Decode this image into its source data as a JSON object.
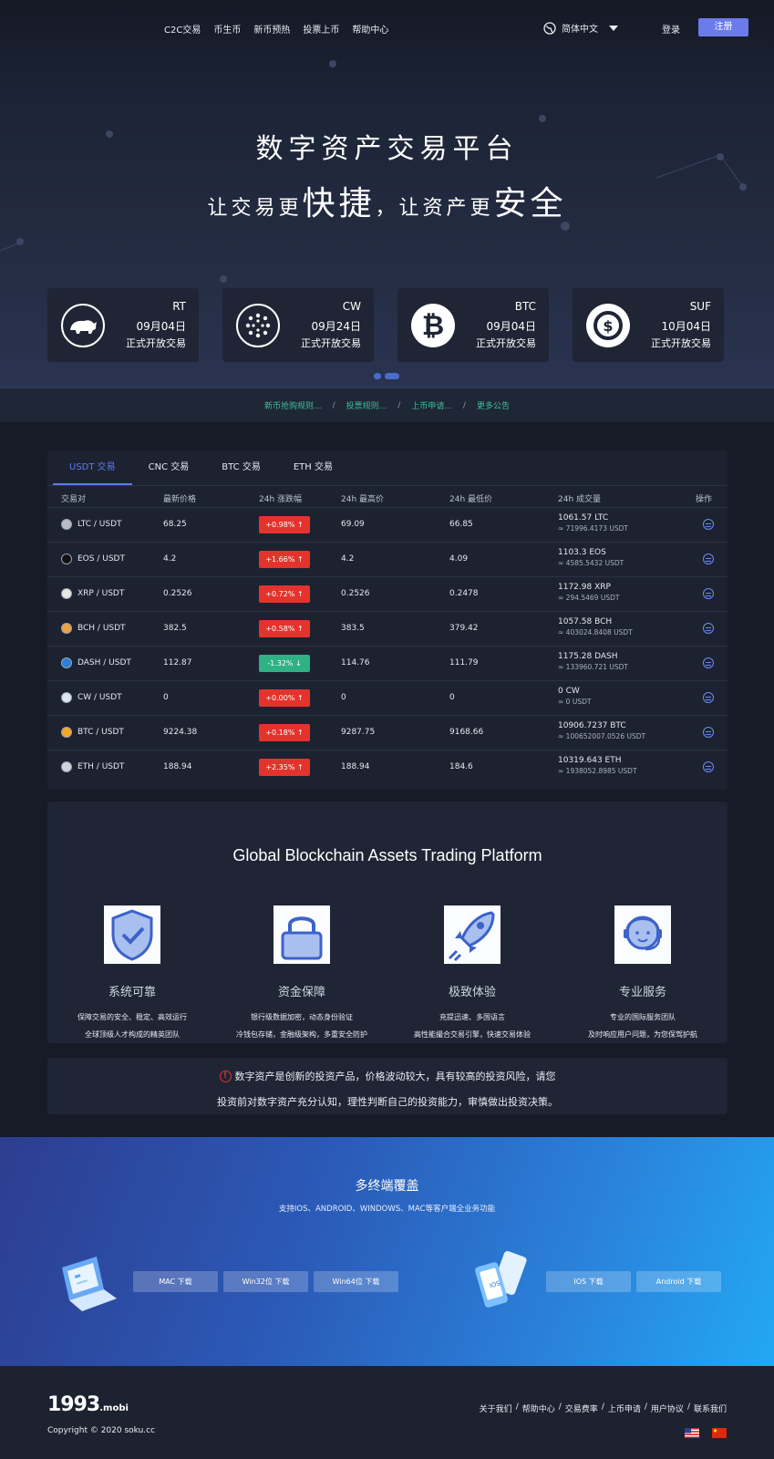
{
  "nav": {
    "links": [
      "C2C交易",
      "币生币",
      "新币预热",
      "投票上币",
      "帮助中心"
    ],
    "language": "简体中文",
    "login": "登录",
    "register": "注册"
  },
  "hero": {
    "title": "数字资产交易平台",
    "sub_a": "让交易更",
    "sub_big_a": "快捷",
    "sub_b": "，让资产更",
    "sub_big_b": "安全"
  },
  "listings": [
    {
      "coin": "RT",
      "date": "09月04日",
      "status": "正式开放交易",
      "icon": "rhino-icon"
    },
    {
      "coin": "CW",
      "date": "09月24日",
      "status": "正式开放交易",
      "icon": "network-icon"
    },
    {
      "coin": "BTC",
      "date": "09月04日",
      "status": "正式开放交易",
      "icon": "bitcoin-icon"
    },
    {
      "coin": "SUF",
      "date": "10月04日",
      "status": "正式开放交易",
      "icon": "dollar-icon"
    }
  ],
  "notices": [
    "新币抢购规则...",
    "投票规则...",
    "上币申请...",
    "更多公告"
  ],
  "notice_sep": "/",
  "market": {
    "tabs": [
      "USDT 交易",
      "CNC 交易",
      "BTC 交易",
      "ETH 交易"
    ],
    "headers": [
      "交易对",
      "最新价格",
      "24h 涨跌幅",
      "24h 最高价",
      "24h 最低价",
      "24h 成交量",
      "操作"
    ],
    "rows": [
      {
        "pair": "LTC / USDT",
        "price": "68.25",
        "change": "+0.98% ↑",
        "dir": "up",
        "high": "69.09",
        "low": "66.85",
        "vol": "1061.57 LTC",
        "vol_usdt": "≈ 71996.4173 USDT",
        "color": "#b8bcc6"
      },
      {
        "pair": "EOS / USDT",
        "price": "4.2",
        "change": "+1.66% ↑",
        "dir": "up",
        "high": "4.2",
        "low": "4.09",
        "vol": "1103.3 EOS",
        "vol_usdt": "≈ 4585.5432 USDT",
        "color": "#111111"
      },
      {
        "pair": "XRP / USDT",
        "price": "0.2526",
        "change": "+0.72% ↑",
        "dir": "up",
        "high": "0.2526",
        "low": "0.2478",
        "vol": "1172.98 XRP",
        "vol_usdt": "≈ 294.5469 USDT",
        "color": "#e8e8e8"
      },
      {
        "pair": "BCH / USDT",
        "price": "382.5",
        "change": "+0.58% ↑",
        "dir": "up",
        "high": "383.5",
        "low": "379.42",
        "vol": "1057.58 BCH",
        "vol_usdt": "≈ 403024.8408 USDT",
        "color": "#f0a03c"
      },
      {
        "pair": "DASH / USDT",
        "price": "112.87",
        "change": "-1.32% ↓",
        "dir": "down",
        "high": "114.76",
        "low": "111.79",
        "vol": "1175.28 DASH",
        "vol_usdt": "≈ 133960.721 USDT",
        "color": "#2b7fd9"
      },
      {
        "pair": "CW / USDT",
        "price": "0",
        "change": "+0.00% ↑",
        "dir": "up",
        "high": "0",
        "low": "0",
        "vol": "0 CW",
        "vol_usdt": "≈ 0 USDT",
        "color": "#dfe6f2"
      },
      {
        "pair": "BTC / USDT",
        "price": "9224.38",
        "change": "+0.18% ↑",
        "dir": "up",
        "high": "9287.75",
        "low": "9168.66",
        "vol": "10906.7237 BTC",
        "vol_usdt": "≈ 100652007.0526 USDT",
        "color": "#f5a623"
      },
      {
        "pair": "ETH / USDT",
        "price": "188.94",
        "change": "+2.35% ↑",
        "dir": "up",
        "high": "188.94",
        "low": "184.6",
        "vol": "10319.643 ETH",
        "vol_usdt": "≈ 1938052.8985 USDT",
        "color": "#d0d4dc"
      }
    ]
  },
  "features": {
    "title": "Global Blockchain Assets Trading Platform",
    "items": [
      {
        "name": "系统可靠",
        "line1": "保障交易的安全、稳定、高效运行",
        "line2": "全球顶级人才构成的精英团队",
        "icon": "shield-icon"
      },
      {
        "name": "资金保障",
        "line1": "银行级数据加密，动态身份验证",
        "line2": "冷钱包存储，金融级架构，多重安全防护",
        "icon": "lock-icon"
      },
      {
        "name": "极致体验",
        "line1": "充提迅速、多国语言",
        "line2": "高性能撮合交易引擎，快速交易体验",
        "icon": "rocket-icon"
      },
      {
        "name": "专业服务",
        "line1": "专业的国际服务团队",
        "line2": "及时响应用户问题，为您保驾护航",
        "icon": "support-agent-icon"
      }
    ]
  },
  "risk": {
    "line1": "数字资产是创新的投资产品，价格波动较大，具有较高的投资风险，请您",
    "line2": "投资前对数字资产充分认知，理性判断自己的投资能力，审慎做出投资决策。"
  },
  "download": {
    "title": "多终端覆盖",
    "subtitle": "支持IOS、ANDROID、WINDOWS、MAC等客户端全业务功能",
    "desktop_buttons": [
      "MAC 下载",
      "Win32位 下载",
      "Win64位 下载"
    ],
    "mobile_buttons": [
      "IOS 下载",
      "Android 下载"
    ],
    "phone_label": "IOS"
  },
  "footer": {
    "logo_main": "1993",
    "logo_small": ".mobi",
    "copyright": "Copyright © 2020 soku.cc",
    "links": [
      "关于我们",
      "帮助中心",
      "交易费率",
      "上币申请",
      "用户协议",
      "联系我们"
    ],
    "link_sep": "/"
  },
  "colors": {
    "up": "#e4332d",
    "down": "#2fb184",
    "accent": "#5b7cf0"
  }
}
